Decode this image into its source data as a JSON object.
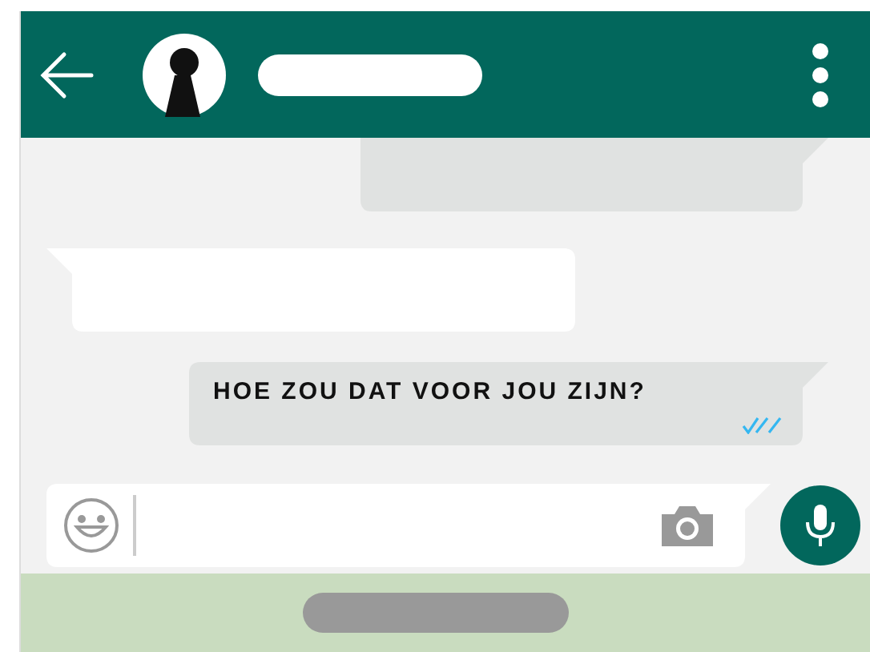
{
  "messages": [
    {
      "kind": "sent"
    },
    {
      "kind": "received"
    },
    {
      "kind": "sent",
      "text": "HOE ZOU DAT VOOR JOU ZIJN?",
      "read": true
    }
  ]
}
